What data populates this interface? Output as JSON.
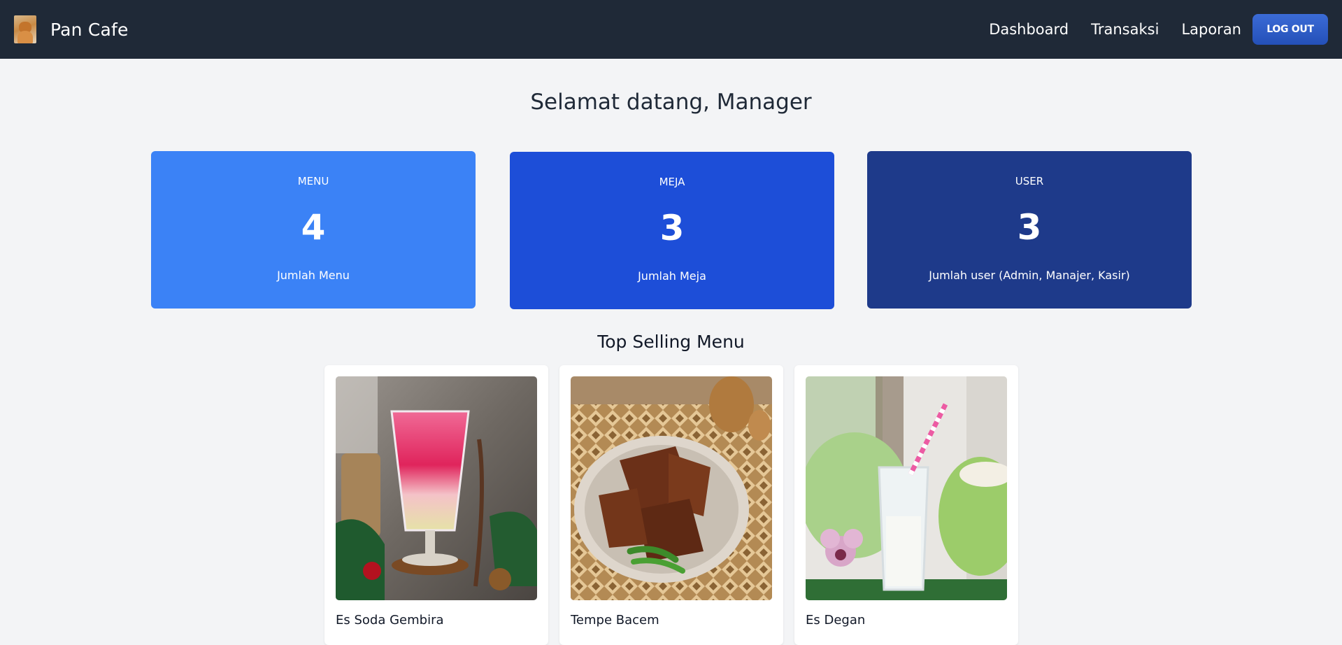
{
  "app": {
    "brand_name": "Pan Cafe",
    "logo_icon": "cat-logo"
  },
  "nav": {
    "links": [
      "Dashboard",
      "Transaksi",
      "Laporan"
    ],
    "logout_label": "LOG OUT"
  },
  "welcome_text": "Selamat datang, Manager",
  "stats": [
    {
      "label": "MENU",
      "value": "4",
      "desc": "Jumlah Menu",
      "color": "#3b82f6"
    },
    {
      "label": "MEJA",
      "value": "3",
      "desc": "Jumlah Meja",
      "color": "#1d4ed8"
    },
    {
      "label": "USER",
      "value": "3",
      "desc": "Jumlah user (Admin, Manajer, Kasir)",
      "color": "#1e3a8a"
    }
  ],
  "top_selling": {
    "title": "Top Selling Menu",
    "items": [
      {
        "name": "Es Soda Gembira",
        "image_icon": "soda-drink-photo"
      },
      {
        "name": "Tempe Bacem",
        "image_icon": "tempe-plate-photo"
      },
      {
        "name": "Es Degan",
        "image_icon": "coconut-drink-photo"
      }
    ]
  }
}
